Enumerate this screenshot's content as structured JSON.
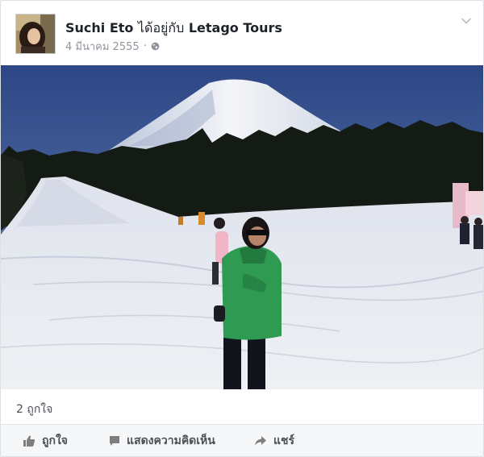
{
  "post": {
    "author": "Suchi Eto",
    "with_text": "ได้อยู่กับ",
    "tagged_page": "Letago Tours",
    "date": "4 มีนาคม 2555",
    "separator": "·",
    "privacy_icon": "globe-icon",
    "menu_icon": "chevron-down-icon"
  },
  "reactions": {
    "likes_label": "2 ถูกใจ"
  },
  "actions": {
    "like_label": "ถูกใจ",
    "comment_label": "แสดงความคิดเห็น",
    "share_label": "แชร์",
    "like_icon": "thumbs-up-icon",
    "comment_icon": "comment-icon",
    "share_icon": "share-arrow-icon"
  },
  "colors": {
    "sky": "#2f4a86",
    "snow": "#e4e7ee",
    "forest": "#141a14",
    "jacket": "#2f9a52",
    "meta_text": "#90949c",
    "action_text": "#4b4f56"
  }
}
